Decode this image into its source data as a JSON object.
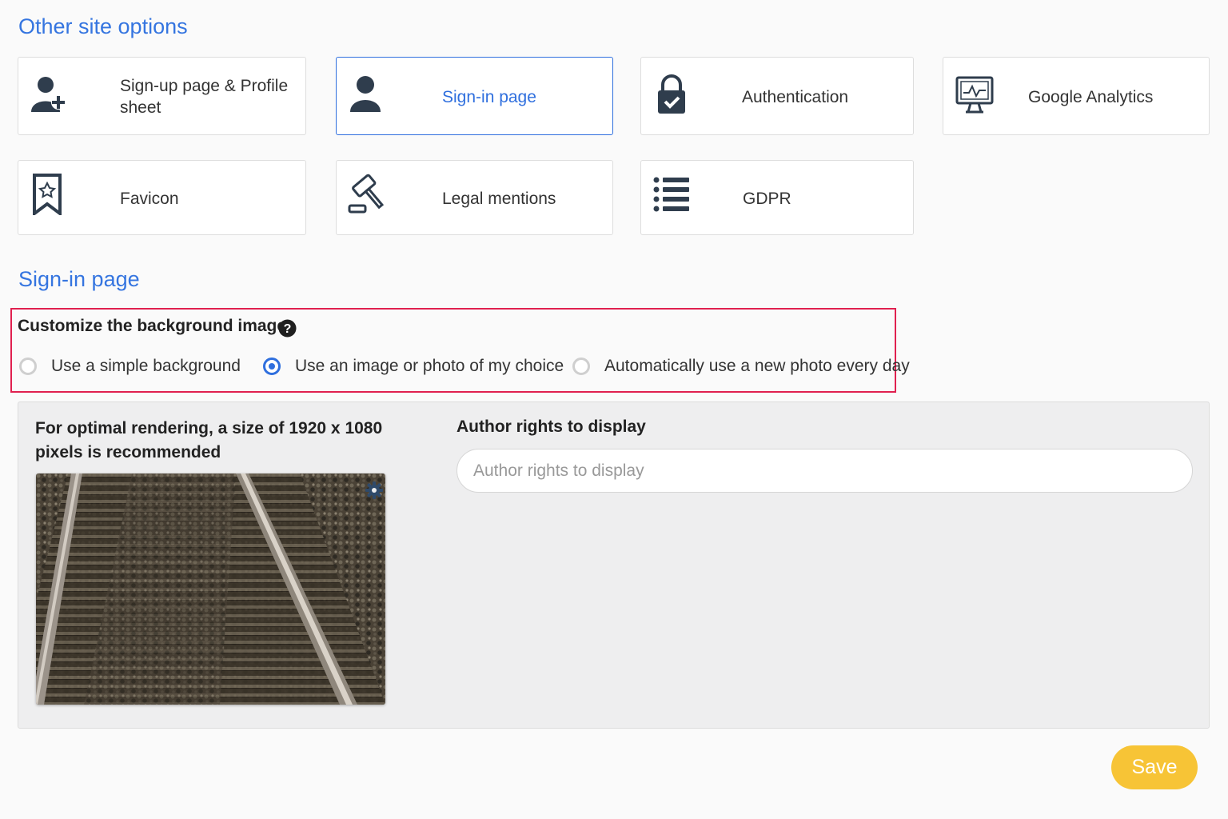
{
  "header": {
    "title": "Other site options"
  },
  "options": [
    {
      "label": "Sign-up page & Profile sheet",
      "icon": "user-plus-icon"
    },
    {
      "label": "Sign-in page",
      "icon": "user-icon",
      "active": true
    },
    {
      "label": "Authentication",
      "icon": "lock-check-icon"
    },
    {
      "label": "Google Analytics",
      "icon": "monitor-chart-icon"
    },
    {
      "label": "Favicon",
      "icon": "bookmark-star-icon"
    },
    {
      "label": "Legal mentions",
      "icon": "gavel-icon"
    },
    {
      "label": "GDPR",
      "icon": "list-icon"
    }
  ],
  "signin": {
    "section_title": "Sign-in page",
    "background": {
      "title": "Customize the background image",
      "help_icon": "question-circle-icon",
      "choices": [
        {
          "label": "Use a simple background",
          "checked": false
        },
        {
          "label": "Use an image or photo of my choice",
          "checked": true
        },
        {
          "label": "Automatically use a new photo every day",
          "checked": false
        }
      ]
    },
    "render_note": "For optimal rendering, a size of  1920 x 1080 pixels is recommended",
    "author": {
      "label": "Author rights to display",
      "placeholder": "Author rights to display",
      "value": ""
    },
    "settings_icon": "gear-icon"
  },
  "save_label": "Save",
  "colors": {
    "accent": "#2f6fde",
    "heading": "#3575e0",
    "highlight_border": "#e0204f",
    "save_button": "#f7c436",
    "icon_dark": "#2f3d4d"
  }
}
